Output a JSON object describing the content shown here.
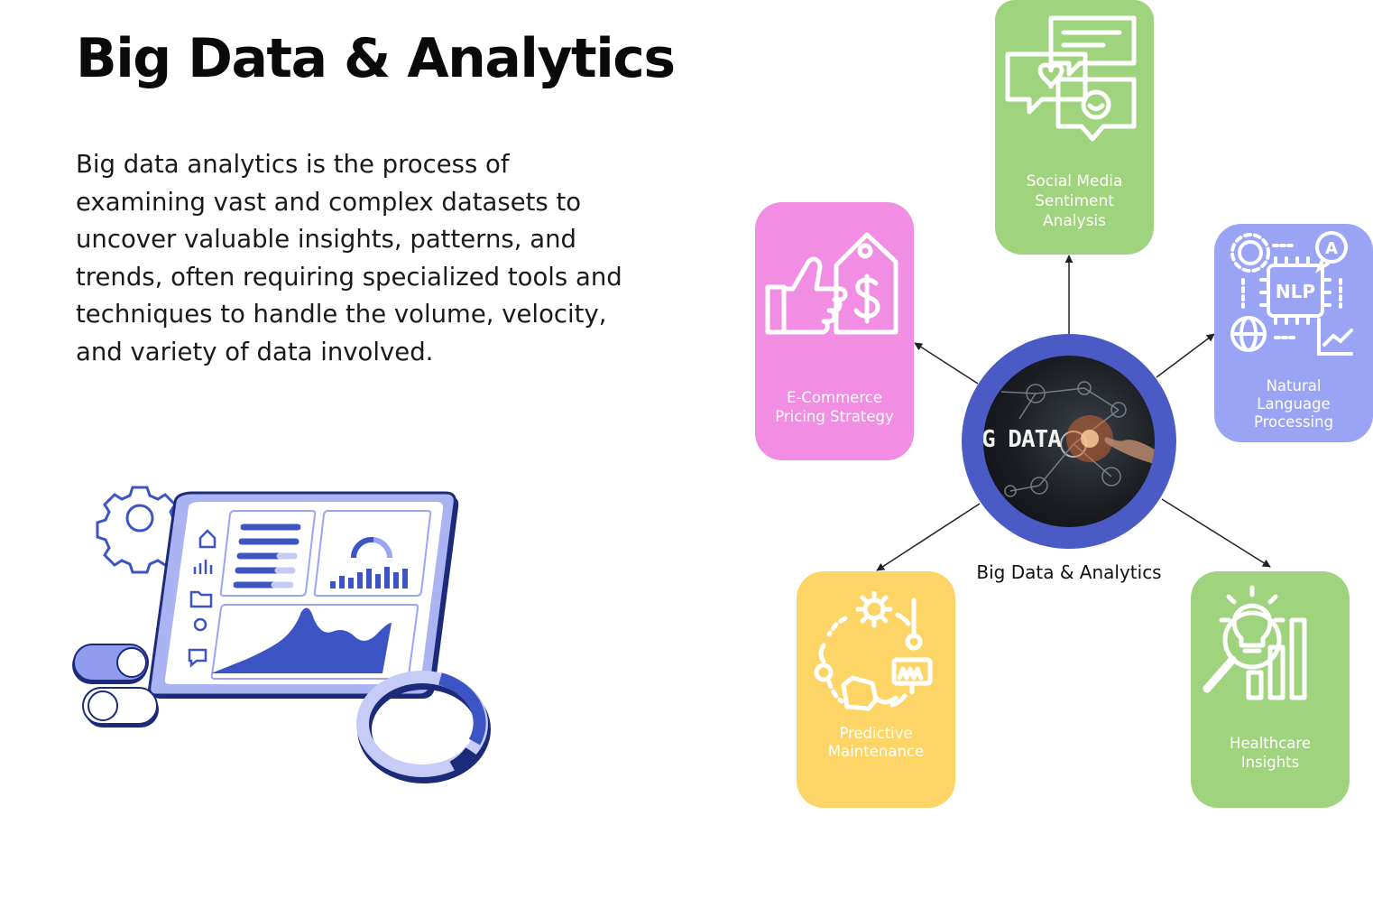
{
  "title": "Big Data & Analytics",
  "description": "Big data analytics is the process of examining vast and complex datasets to uncover valuable insights, patterns, and trends, often requiring specialized tools and techniques to handle the volume, velocity, and variety of data involved.",
  "hub": {
    "caption": "Big Data & Analytics",
    "image_text": "G DATA",
    "color": "#4a5bc6"
  },
  "cards": {
    "social": {
      "label": "Social Media\nSentiment\nAnalysis",
      "icon": "chat-bubbles-icon",
      "color": "#9fd37e"
    },
    "ecommerce": {
      "label": "E-Commerce\nPricing Strategy",
      "icon": "thumbs-up-price-tag-icon",
      "color": "#f18de2"
    },
    "nlp": {
      "label": "Natural\nLanguage\nProcessing",
      "icon": "nlp-chip-icon",
      "icon_text": "NLP",
      "color": "#9aa4f5"
    },
    "predictive": {
      "label": "Predictive\nMaintenance",
      "icon": "maintenance-cycle-icon",
      "color": "#fdd566"
    },
    "healthcare": {
      "label": "Healthcare\nInsights",
      "icon": "insights-bulb-chart-icon",
      "color": "#9fd37e"
    }
  },
  "illustration": {
    "icon": "dashboard-tablet-illustration",
    "accent": "#3d55c4"
  }
}
